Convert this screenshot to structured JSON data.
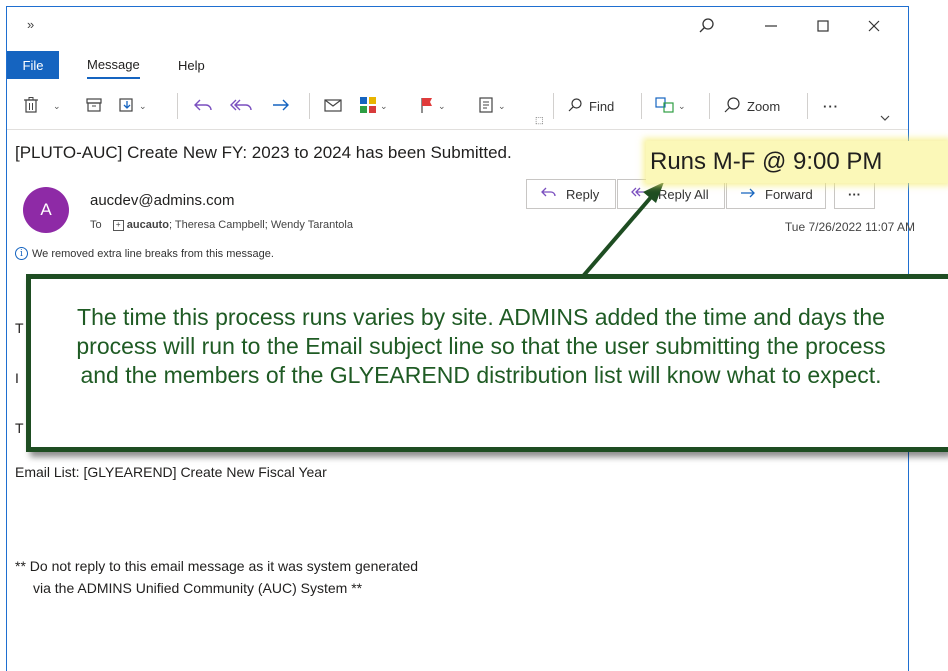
{
  "window": {
    "expand_glyph": "»",
    "tabs": {
      "file": "File",
      "message": "Message",
      "help": "Help"
    },
    "ribbon": {
      "find_label": "Find",
      "zoom_label": "Zoom",
      "more_label": "···"
    }
  },
  "message": {
    "subject": "[PLUTO-AUC] Create New FY: 2023 to 2024 has been Submitted.",
    "avatar_initial": "A",
    "sender": "aucdev@admins.com",
    "to_prefix": "To",
    "to_group": "aucauto",
    "to_rest": "; Theresa Campbell; Wendy Tarantola",
    "date": "Tue 7/26/2022 11:07 AM",
    "actions": {
      "reply": "Reply",
      "reply_all": "Reply All",
      "forward": "Forward",
      "more": "···"
    },
    "info_notice": "We removed extra line breaks from this message.",
    "partial_body": {
      "line1": "T",
      "line2": "I",
      "line3": "T"
    },
    "email_list": "Email List: [GLYEAREND] Create New Fiscal Year",
    "footer_line1": "** Do not reply to this email message as it was system generated",
    "footer_line2": "via the ADMINS Unified Community (AUC) System **"
  },
  "annotation": {
    "tag": "Runs M-F @ 9:00 PM",
    "text": "The time this process runs varies by site. ADMINS added the time and days the process will run to the Email subject line so that the user submitting the process and the members of the GLYEAREND distribution list will know what to expect.",
    "tag_color": "#fbf8b8",
    "border_color": "#1e4d22",
    "text_color": "#1f5b24"
  },
  "colors": {
    "accent": "#1564c0",
    "avatar": "#8e2aa6"
  }
}
